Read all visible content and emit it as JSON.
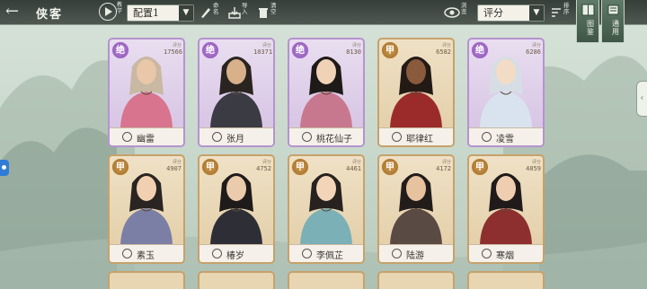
{
  "header": {
    "title": "侠客",
    "tutorial_label": "教学",
    "config_select": "配置1",
    "name_label": "命名",
    "import_label": "导入",
    "clear_label": "清空",
    "view_label": "浏览",
    "sort_select": "评分",
    "sort_order_label": "排序",
    "tab_atlas": "图鉴",
    "tab_general": "通用"
  },
  "cards": [
    {
      "name": "幽雷",
      "grade": "绝",
      "power": "17566",
      "rarity": "purple"
    },
    {
      "name": "张月",
      "grade": "绝",
      "power": "10371",
      "rarity": "purple"
    },
    {
      "name": "桃花仙子",
      "grade": "绝",
      "power": "8130",
      "rarity": "purple"
    },
    {
      "name": "耶律红",
      "grade": "甲",
      "power": "6582",
      "rarity": "gold"
    },
    {
      "name": "凌雪",
      "grade": "绝",
      "power": "6286",
      "rarity": "purple"
    },
    {
      "name": "素玉",
      "grade": "甲",
      "power": "4907",
      "rarity": "gold"
    },
    {
      "name": "椿岁",
      "grade": "甲",
      "power": "4752",
      "rarity": "gold"
    },
    {
      "name": "李佩芷",
      "grade": "甲",
      "power": "4461",
      "rarity": "gold"
    },
    {
      "name": "陆游",
      "grade": "甲",
      "power": "4172",
      "rarity": "gold"
    },
    {
      "name": "寒烟",
      "grade": "甲",
      "power": "4059",
      "rarity": "gold"
    }
  ],
  "power_label": "评分",
  "colors": {
    "purple_border": "#b593cf",
    "gold_border": "#c7a16a",
    "topbar": "#2f3832"
  }
}
